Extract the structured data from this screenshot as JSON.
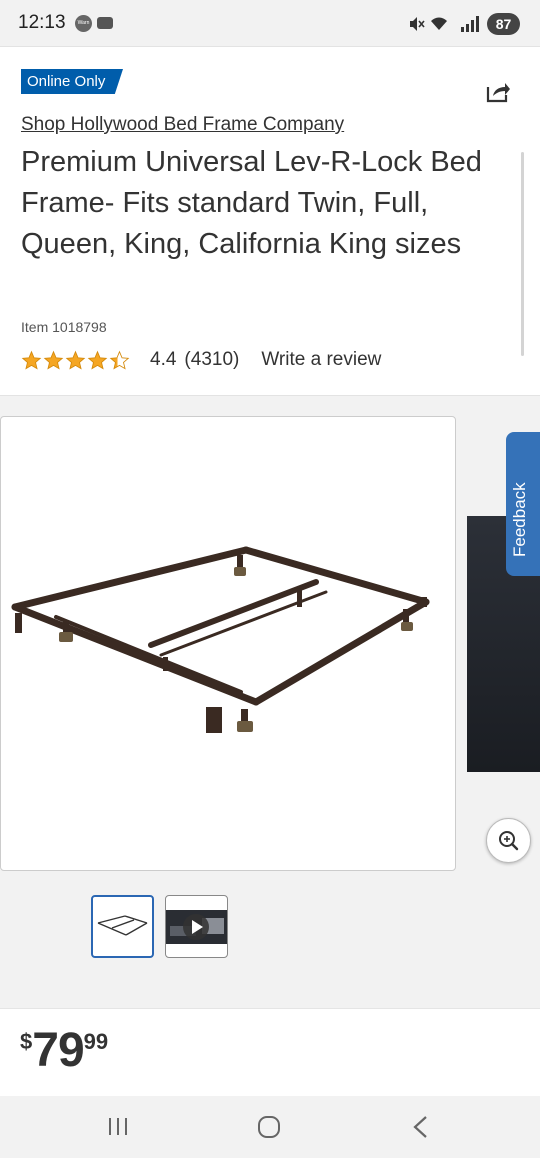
{
  "status_bar": {
    "time": "12:13",
    "weather_icon_text": "Warn",
    "battery": "87"
  },
  "product": {
    "badge": "Online Only",
    "brand_link": "Shop Hollywood Bed Frame Company",
    "title": "Premium Universal Lev-R-Lock Bed Frame- Fits standard Twin, Full, Queen, King, California King sizes",
    "item_number": "Item 1018798",
    "rating_value": "4.4",
    "rating_count": "(4310)",
    "rating_stars": 4.4,
    "write_review": "Write a review"
  },
  "feedback": {
    "label": "Feedback"
  },
  "price": {
    "currency": "$",
    "dollars": "79",
    "cents": "99"
  },
  "colors": {
    "badge_blue": "#005dab",
    "star_gold": "#f5a623",
    "feedback_blue": "#3572b8"
  }
}
